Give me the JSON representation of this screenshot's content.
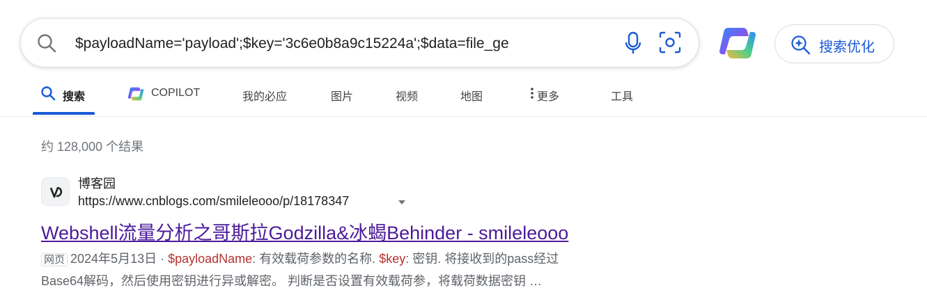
{
  "search": {
    "query": "$payloadName='payload';$key='3c6e0b8a9c15224a';$data=file_ge",
    "placeholder": ""
  },
  "copilot_button": {
    "label": "搜索优化"
  },
  "tabs": [
    {
      "label": "搜索",
      "icon": "search-icon",
      "active": true
    },
    {
      "label": "COPILOT",
      "icon": "copilot-icon",
      "active": false
    },
    {
      "label": "我的必应",
      "active": false
    },
    {
      "label": "图片",
      "active": false
    },
    {
      "label": "视频",
      "active": false
    },
    {
      "label": "地图",
      "active": false
    },
    {
      "label": "更多",
      "icon": "more-vertical-icon",
      "active": false
    },
    {
      "label": "工具",
      "active": false
    }
  ],
  "results_info": {
    "count_text": "约 128,000 个结果"
  },
  "results": [
    {
      "site_name": "博客园",
      "url": "https://www.cnblogs.com/smileleooo/p/18178347",
      "title": "Webshell流量分析之哥斯拉Godzilla&冰蝎Behinder - smileleooo",
      "badge": "网页",
      "date": "2024年5月13日",
      "separator": " · ",
      "snippet_parts": [
        {
          "text": "$payloadName",
          "highlight": true
        },
        {
          "text": ": 有效载荷参数的名称. ",
          "highlight": false
        },
        {
          "text": "$key",
          "highlight": true
        },
        {
          "text": ": 密钥. 将接收到的pass经过",
          "highlight": false
        }
      ],
      "snippet_line2": "Base64解码，然后使用密钥进行异或解密。 判断是否设置有效载荷参，将载荷数据密钥 …"
    }
  ],
  "colors": {
    "accent": "#1a5ad7",
    "visited_title": "#4b1a9a",
    "keyword": "#b5322f",
    "muted": "#70757a"
  }
}
